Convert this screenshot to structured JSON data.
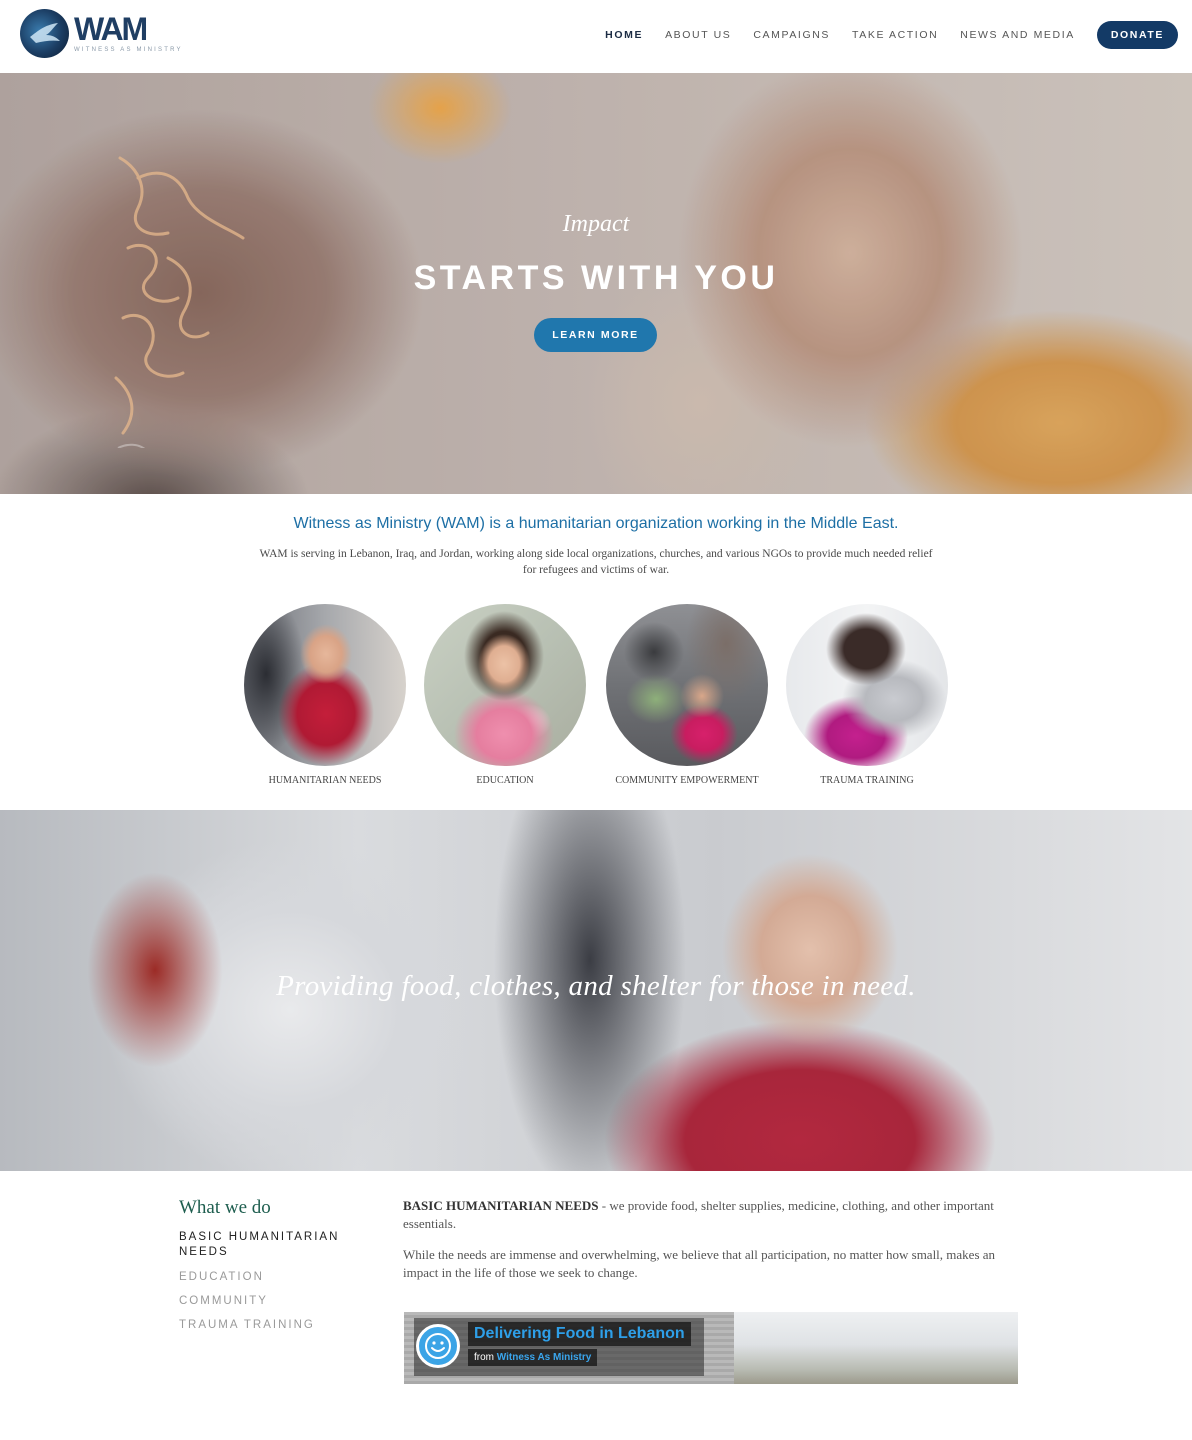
{
  "header": {
    "logo_text": "WAM",
    "logo_sub": "WITNESS AS MINISTRY",
    "nav": [
      {
        "label": "HOME"
      },
      {
        "label": "ABOUT US"
      },
      {
        "label": "CAMPAIGNS"
      },
      {
        "label": "TAKE ACTION"
      },
      {
        "label": "NEWS AND MEDIA"
      }
    ],
    "donate_label": "DONATE"
  },
  "hero": {
    "kicker": "Impact",
    "title": "STARTS WITH YOU",
    "button_label": "LEARN MORE"
  },
  "intro": {
    "headline": "Witness as Ministry (WAM) is a humanitarian organization working in the Middle East.",
    "text": "WAM is serving in Lebanon, Iraq, and Jordan, working along side local organizations, churches, and various NGOs to provide much needed relief for refugees and victims of war."
  },
  "focus_areas": [
    {
      "label": "HUMANITARIAN NEEDS"
    },
    {
      "label": "EDUCATION"
    },
    {
      "label": "COMMUNITY EMPOWERMENT"
    },
    {
      "label": "TRAUMA TRAINING"
    }
  ],
  "banner": {
    "text": "Providing food, clothes, and shelter for those in need."
  },
  "what_we_do": {
    "title": "What we do",
    "links": [
      {
        "label": "BASIC HUMANITARIAN NEEDS",
        "active": true
      },
      {
        "label": "EDUCATION",
        "active": false
      },
      {
        "label": "COMMUNITY",
        "active": false
      },
      {
        "label": "TRAUMA TRAINING",
        "active": false
      }
    ],
    "lead": "BASIC HUMANITARIAN NEEDS",
    "lead_rest": " - we provide food, shelter supplies, medicine, clothing, and other important essentials.",
    "paragraph": "While the needs are immense and overwhelming, we believe that all participation, no matter how small, makes an impact in the life of those we seek to change.",
    "video": {
      "title": "Delivering Food in Lebanon",
      "from_prefix": "from",
      "from_name": "Witness As Ministry"
    }
  },
  "colors": {
    "brand_navy": "#133a66",
    "accent_blue": "#2077ad",
    "heading_green": "#1e5e4f"
  }
}
